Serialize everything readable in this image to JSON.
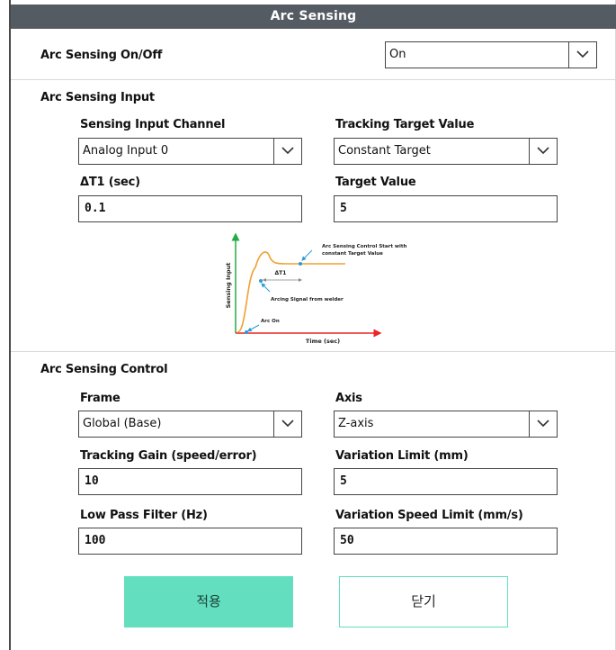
{
  "dialog": {
    "title": "Arc Sensing"
  },
  "onoff": {
    "label": "Arc Sensing On/Off",
    "value": "On"
  },
  "input_section": {
    "title": "Arc Sensing Input",
    "channel": {
      "label": "Sensing Input Channel",
      "value": "Analog Input 0"
    },
    "tracking": {
      "label": "Tracking Target Value",
      "value": "Constant Target"
    },
    "dt1": {
      "label": "ΔT1 (sec)",
      "value": "0.1"
    },
    "target": {
      "label": "Target Value",
      "value": "5"
    },
    "diagram": {
      "y_label": "Sensing Input",
      "x_label": "Time (sec)",
      "annot_start_1": "Arc Sensing Control Start with",
      "annot_start_2": "constant Target Value",
      "annot_dt1": "ΔT1",
      "annot_arcing": "Arcing Signal from welder",
      "annot_arc_on": "Arc On",
      "colors": {
        "y_axis": "#22aa44",
        "x_axis": "#ee2222",
        "curve": "#f0a030",
        "marker": "#2a9bd8"
      }
    }
  },
  "control_section": {
    "title": "Arc Sensing Control",
    "frame": {
      "label": "Frame",
      "value": "Global (Base)"
    },
    "axis": {
      "label": "Axis",
      "value": "Z-axis"
    },
    "gain": {
      "label": "Tracking Gain (speed/error)",
      "value": "10"
    },
    "variation_limit": {
      "label": "Variation Limit (mm)",
      "value": "5"
    },
    "lpf": {
      "label": "Low Pass Filter (Hz)",
      "value": "100"
    },
    "variation_speed": {
      "label": "Variation Speed Limit (mm/s)",
      "value": "50"
    }
  },
  "buttons": {
    "apply": "적용",
    "close": "닫기",
    "accent": "#63dfbf"
  },
  "icons": {
    "dropdown": "chevron-down-icon"
  }
}
